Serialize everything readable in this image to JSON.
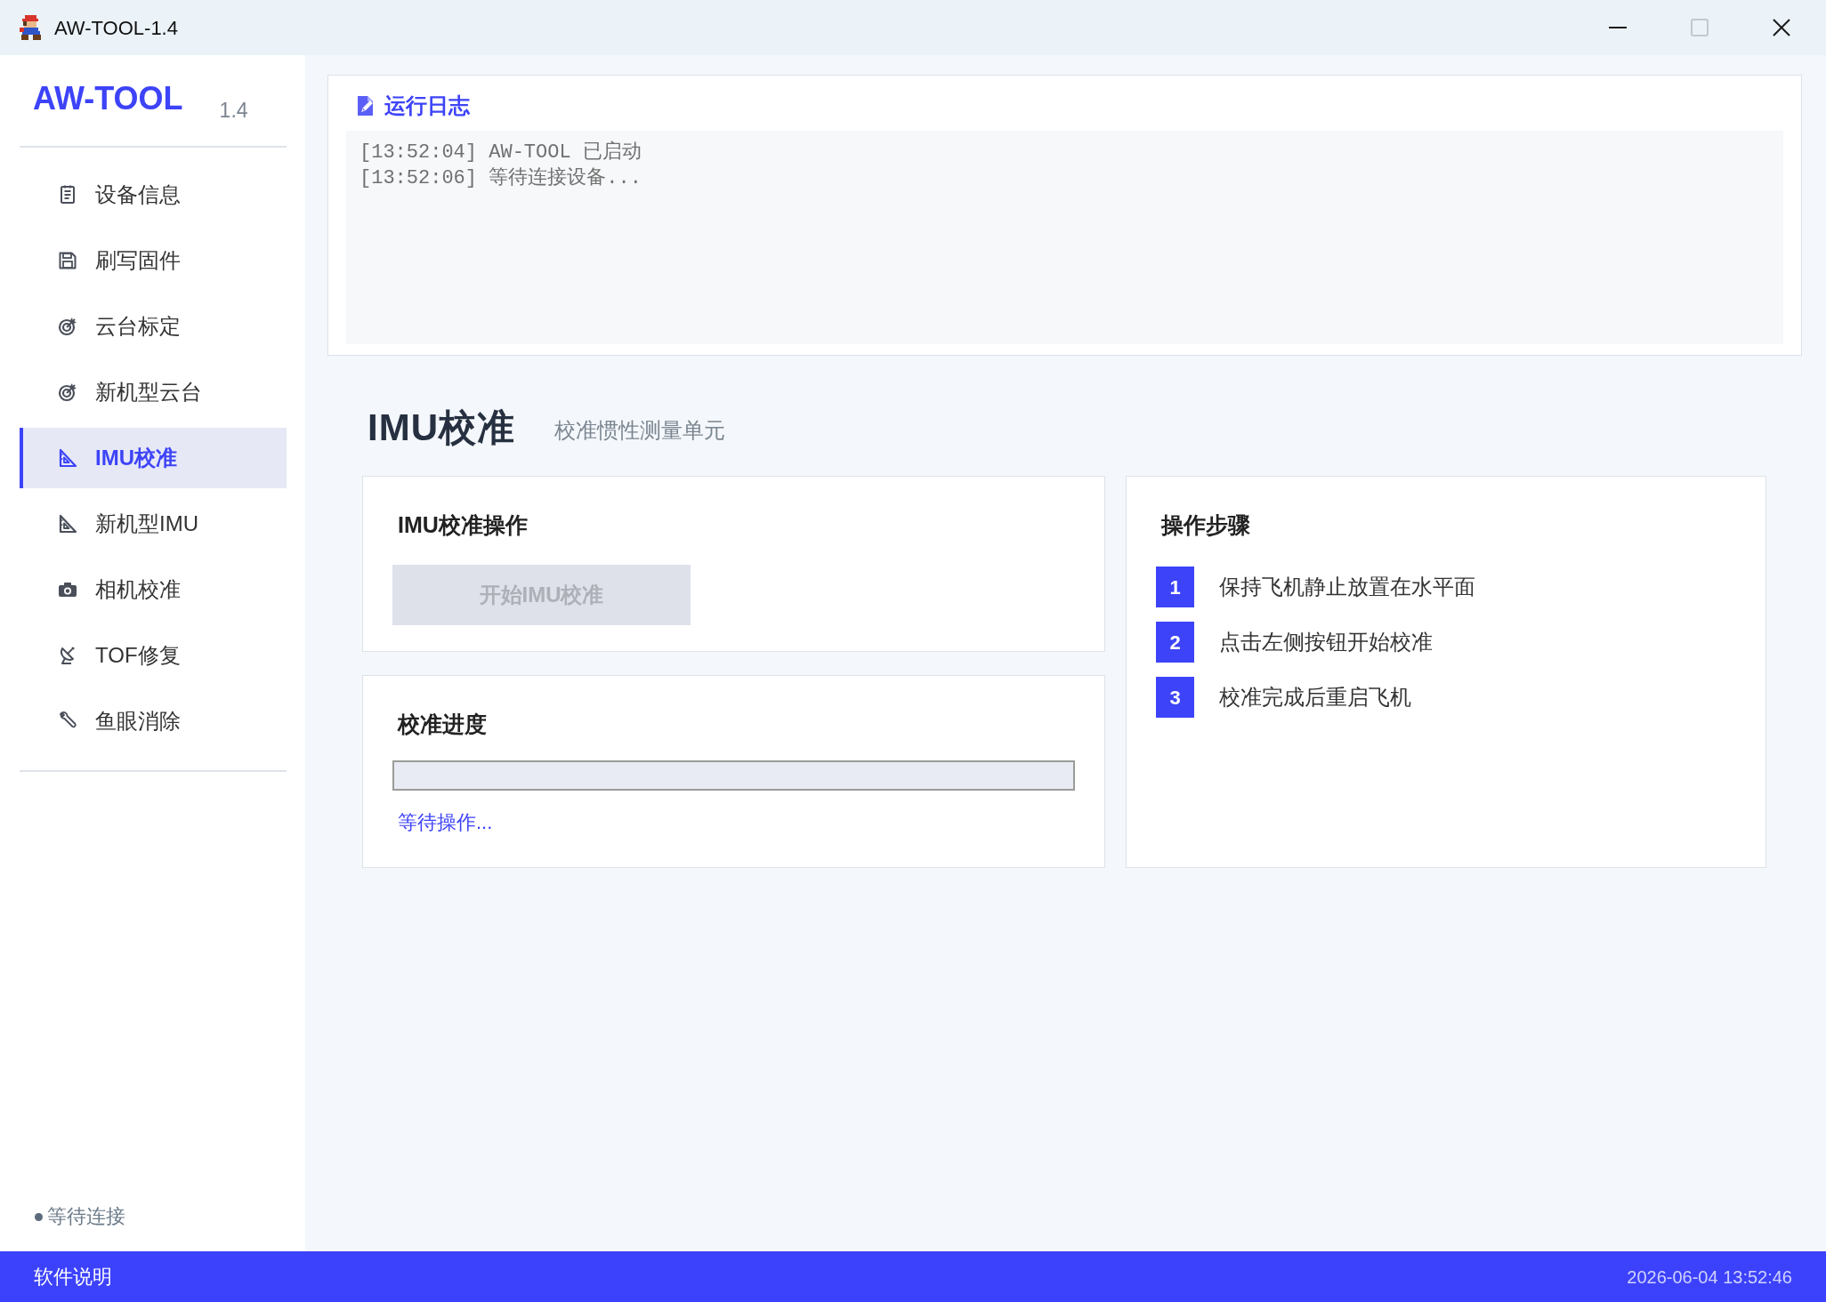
{
  "window": {
    "title": "AW-TOOL-1.4",
    "controls": [
      {
        "kind": "minimize",
        "disabled": false
      },
      {
        "kind": "maximize",
        "disabled": true
      },
      {
        "kind": "close",
        "disabled": false
      }
    ]
  },
  "sidebar": {
    "brand": "AW-TOOL",
    "version": "1.4",
    "items": [
      {
        "label": "设备信息",
        "selected": false
      },
      {
        "label": "刷写固件",
        "selected": false
      },
      {
        "label": "云台标定",
        "selected": false
      },
      {
        "label": "新机型云台",
        "selected": false
      },
      {
        "label": "IMU校准",
        "selected": true
      },
      {
        "label": "新机型IMU",
        "selected": false
      },
      {
        "label": "相机校准",
        "selected": false
      },
      {
        "label": "TOF修复",
        "selected": false
      },
      {
        "label": "鱼眼消除",
        "selected": false
      }
    ],
    "connection": {
      "label": "等待连接",
      "connected": false
    }
  },
  "log": {
    "title": "运行日志",
    "lines": [
      "[13:52:04] AW-TOOL 已启动",
      "[13:52:06] 等待连接设备..."
    ]
  },
  "page": {
    "title": "IMU校准",
    "subtitle": "校准惯性测量单元"
  },
  "operation_card": {
    "title": "IMU校准操作",
    "button": {
      "label": "开始IMU校准",
      "disabled": true
    }
  },
  "progress_card": {
    "title": "校准进度",
    "level": 0,
    "status": "等待操作..."
  },
  "steps_card": {
    "title": "操作步骤",
    "steps": [
      {
        "number": "1",
        "text": "保持飞机静止放置在水平面"
      },
      {
        "number": "2",
        "text": "点击左侧按钮开始校准"
      },
      {
        "number": "3",
        "text": "校准完成后重启飞机"
      }
    ]
  },
  "status_bar": {
    "help": "软件说明",
    "datetime": "2026-06-04 13:52:46"
  }
}
